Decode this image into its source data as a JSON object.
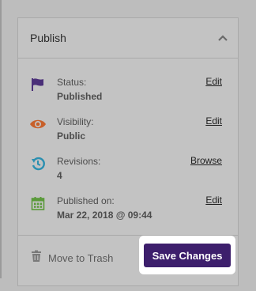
{
  "panel": {
    "title": "Publish",
    "items": [
      {
        "icon": "flag-icon",
        "label": "Status:",
        "value": "Published",
        "action": "Edit"
      },
      {
        "icon": "eye-icon",
        "label": "Visibility:",
        "value": "Public",
        "action": "Edit"
      },
      {
        "icon": "history-icon",
        "label": "Revisions:",
        "value": "4",
        "action": "Browse"
      },
      {
        "icon": "calendar-icon",
        "label": "Published on:",
        "value": "Mar 22, 2018 @ 09:44",
        "action": "Edit"
      }
    ],
    "footer": {
      "trash_label": "Move to Trash",
      "save_label": "Save Changes"
    }
  },
  "colors": {
    "accent": "#3d1f6c",
    "flag": "#4a2f78",
    "eye": "#c8602a",
    "history": "#2a8fb0",
    "calendar": "#5a9a3a"
  }
}
